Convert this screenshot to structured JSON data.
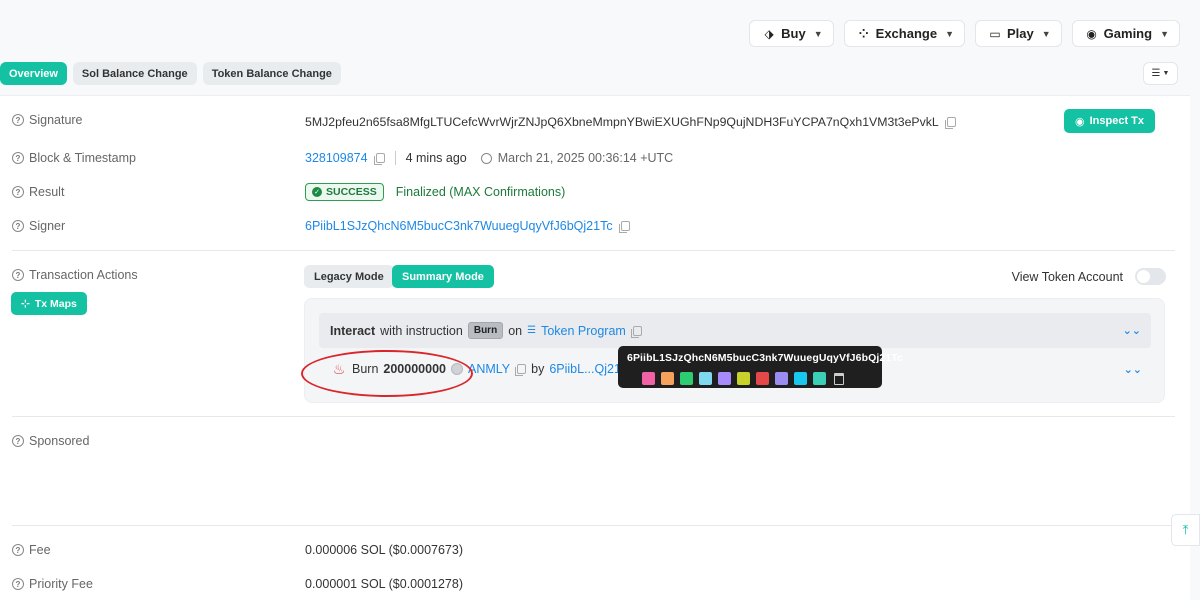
{
  "topnav": [
    {
      "label": "Buy",
      "icon": "tag-icon"
    },
    {
      "label": "Exchange",
      "icon": "exchange-icon"
    },
    {
      "label": "Play",
      "icon": "monitor-icon"
    },
    {
      "label": "Gaming",
      "icon": "gamepad-icon"
    }
  ],
  "tabs": [
    "Overview",
    "Sol Balance Change",
    "Token Balance Change"
  ],
  "fields": {
    "signature_label": "Signature",
    "signature_value": "5MJ2pfeu2n65fsa8MfgLTUCefcWvrWjrZNJpQ6XbneMmpnYBwiEXUGhFNp9QujNDH3FuYCPA7nQxh1VM3t3ePvkL",
    "inspect_label": "Inspect Tx",
    "block_label": "Block & Timestamp",
    "block_value": "328109874",
    "ago": "4 mins ago",
    "timestamp": "March 21, 2025 00:36:14 +UTC",
    "result_label": "Result",
    "result_badge": "SUCCESS",
    "result_text": "Finalized (MAX Confirmations)",
    "signer_label": "Signer",
    "signer_value": "6PiibL1SJzQhcN6M5bucC3nk7WuuegUqyVfJ6bQj21Tc",
    "tx_actions_label": "Transaction Actions",
    "tx_maps_label": "Tx Maps",
    "legacy_mode": "Legacy Mode",
    "summary_mode": "Summary Mode",
    "view_token_account": "View Token Account",
    "sponsored_label": "Sponsored",
    "fee_label": "Fee",
    "fee_value": "0.000006 SOL ($0.0007673)",
    "priority_fee_label": "Priority Fee",
    "priority_fee_value": "0.000001 SOL ($0.0001278)"
  },
  "instruction": {
    "interact": "Interact",
    "with_instruction": "with instruction",
    "badge": "Burn",
    "on": "on",
    "program": "Token Program",
    "burn_word": "Burn",
    "amount": "200000000",
    "token": "ANMLY",
    "by": "by",
    "by_addr": "6PiibL...Qj21Tc"
  },
  "tooltip": {
    "address": "6PiibL1SJzQhcN6M5bucC3nk7WuuegUqyVfJ6bQj21Tc",
    "swatches": [
      "#f062a6",
      "#f5a25d",
      "#2ecc71",
      "#7fd8ef",
      "#a78bfa",
      "#c7d22a",
      "#e54848",
      "#9b8cf2",
      "#19c8ef",
      "#3ccfb6"
    ]
  },
  "colors": {
    "accent": "#14c2a3",
    "link": "#1e88e5",
    "success": "#1d7a3a",
    "highlight": "#d9262b"
  }
}
